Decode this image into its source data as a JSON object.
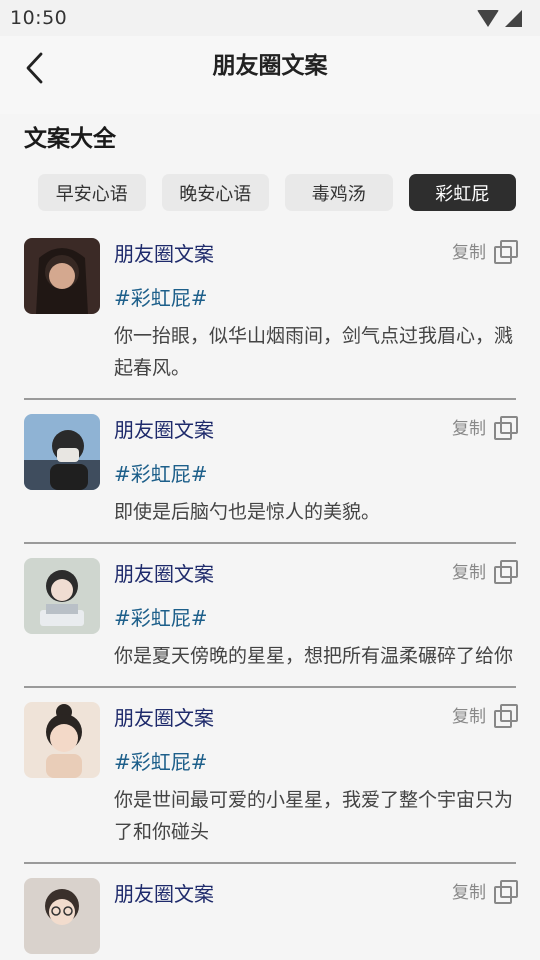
{
  "status": {
    "time": "10:50"
  },
  "nav": {
    "title": "朋友圈文案"
  },
  "section": {
    "title": "文案大全"
  },
  "tabs": [
    {
      "label": "早安心语",
      "active": false
    },
    {
      "label": "晚安心语",
      "active": false
    },
    {
      "label": "毒鸡汤",
      "active": false
    },
    {
      "label": "彩虹屁",
      "active": true
    }
  ],
  "copy_label": "复制",
  "items": [
    {
      "title": "朋友圈文案",
      "tag": "#彩虹屁#",
      "text": "你一抬眼，似华山烟雨间，剑气点过我眉心，溅起春风。",
      "avatar_color": "#5a3a32"
    },
    {
      "title": "朋友圈文案",
      "tag": "#彩虹屁#",
      "text": "即使是后脑勺也是惊人的美貌。",
      "avatar_color": "#6e8fb0"
    },
    {
      "title": "朋友圈文案",
      "tag": "#彩虹屁#",
      "text": "你是夏天傍晚的星星，想把所有温柔碾碎了给你",
      "avatar_color": "#7f8b80"
    },
    {
      "title": "朋友圈文案",
      "tag": "#彩虹屁#",
      "text": "你是世间最可爱的小星星，我爱了整个宇宙只为了和你碰头",
      "avatar_color": "#d8b69c"
    },
    {
      "title": "朋友圈文案",
      "tag": "",
      "text": "",
      "avatar_color": "#c7b3a6"
    }
  ]
}
